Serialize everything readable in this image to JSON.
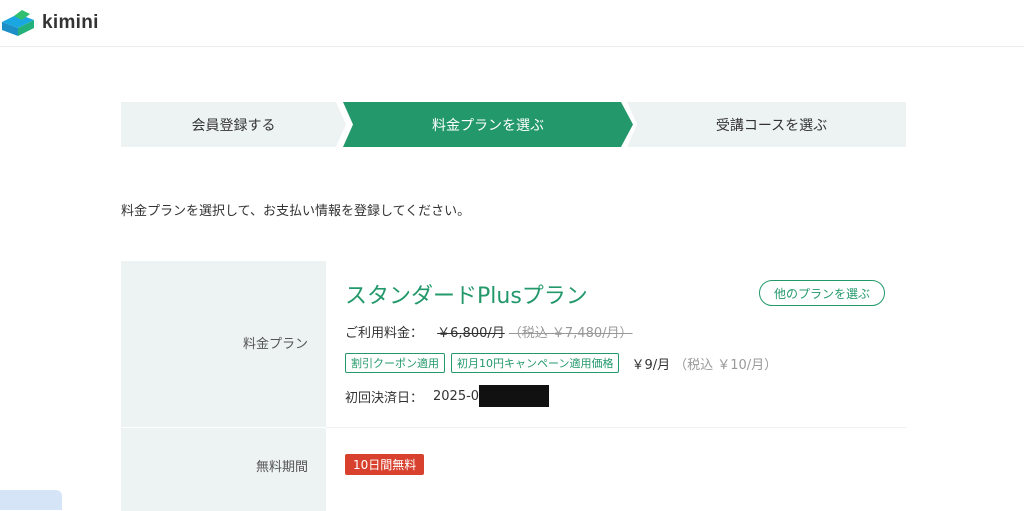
{
  "header": {
    "brand": "kimini"
  },
  "steps": [
    {
      "label": "会員登録する"
    },
    {
      "label": "料金プランを選ぶ"
    },
    {
      "label": "受講コースを選ぶ"
    }
  ],
  "intro": "料金プランを選択して、お支払い情報を登録してください。",
  "plan_row": {
    "label": "料金プラン",
    "plan_name": "スタンダードPlusプラン",
    "other_plan_button": "他のプランを選ぶ",
    "fee_label": "ご利用料金：",
    "old_price": "￥6,800/月",
    "old_price_tax": "（税込 ￥7,480/月）",
    "tags": [
      "割引クーポン適用",
      "初月10円キャンペーン適用価格"
    ],
    "new_price": "￥9/月",
    "new_price_tax": "（税込 ￥10/月）",
    "first_payment_label": "初回決済日：",
    "first_payment_value": "2025-0"
  },
  "free_row": {
    "label": "無料期間",
    "badge": "10日間無料"
  },
  "colors": {
    "accent": "#23996b",
    "badge": "#d8412e",
    "step_bg": "#edf3f3"
  }
}
